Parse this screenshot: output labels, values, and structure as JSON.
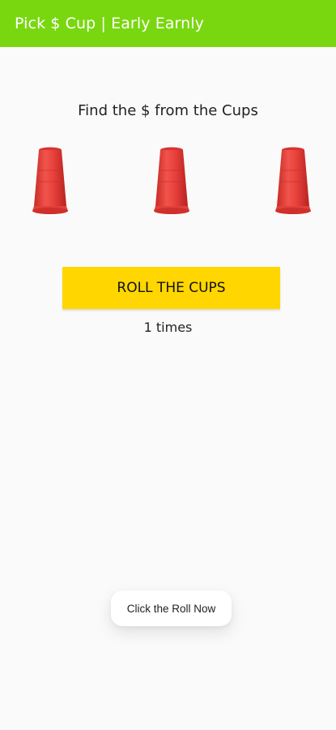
{
  "app_bar": {
    "title": "Pick $ Cup | Early Earnly",
    "color": "#79d70f"
  },
  "game": {
    "instruction": "Find the $ from the Cups",
    "cups": [
      {
        "icon": "red-cup-icon"
      },
      {
        "icon": "red-cup-icon"
      },
      {
        "icon": "red-cup-icon"
      }
    ],
    "cup_color": "#e8413c"
  },
  "roll_button": {
    "label": "ROLL THE CUPS",
    "color": "#ffd600"
  },
  "roll_count": {
    "text": "1 times"
  },
  "toast": {
    "message": "Click the Roll Now"
  }
}
